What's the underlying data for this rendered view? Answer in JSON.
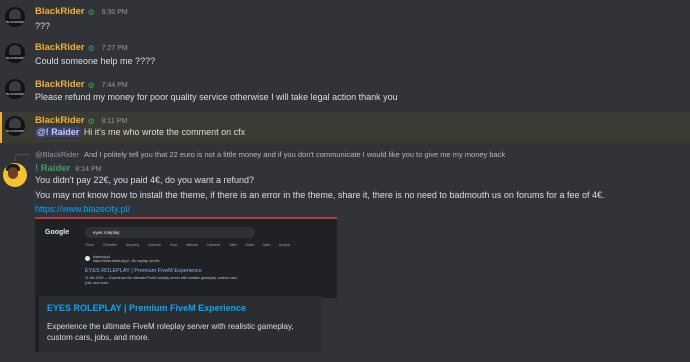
{
  "messages": [
    {
      "user": "BlackRider",
      "time": "6:30 PM",
      "text": "???"
    },
    {
      "user": "BlackRider",
      "time": "7:27 PM",
      "text": "Could someone help me ????"
    },
    {
      "user": "BlackRider",
      "time": "7:44 PM",
      "text": "Please refund my money for poor quality service otherwise I will take legal action thank you"
    },
    {
      "user": "BlackRider",
      "time": "8:11 PM",
      "mention": "@! Raider",
      "text": "Hi it's me who wrote the comment on cfx"
    }
  ],
  "avatar_tag": "BLACKRIDER",
  "reply_message": {
    "reply_to_user": "@BlackRider",
    "reply_to_text": "And I politely tell you that 22 euro is not a little money and if you don't communicate I would like you to give me my money back",
    "user": "! Raider",
    "time": "8:14 PM",
    "lines": [
      "You didn't pay 22€, you paid 4€, do you want a refund?",
      "You may not know how to install the theme, if there is an error in the theme, share it, there is no need to badmouth us on forums for a fee of 4€."
    ],
    "link": "https://www.blazecity.pl/"
  },
  "screenshot": {
    "logo": "Google",
    "query": "eyes roleplay",
    "tabs": "Tümü Görseller Alışveriş Videolar Kısa videolar Haberler Web Daha fazla Araçlar",
    "site_name": "blazecity.pl",
    "site_url": "https://www.blazecity.pl › Bu sayfayı çevirin",
    "result_title": "EYES ROLEPLAY | Premium FiveM Experience",
    "result_desc_1": "11 Nis 2025 — Experience the ultimate FiveM roleplay server with realistic gameplay, custom cars,",
    "result_desc_2": "jobs, and more."
  },
  "embed": {
    "title": "EYES ROLEPLAY | Premium FiveM Experience",
    "description": "Experience the ultimate FiveM roleplay server with realistic gameplay, custom cars, jobs, and more."
  },
  "colors": {
    "background": "#313338",
    "username_blackrider": "#f0b232",
    "username_raider": "#3ba55d",
    "link": "#00a8fc",
    "highlight": "#3b3a33"
  },
  "icons": [
    "verified-badge-icon",
    "reply-spine-icon"
  ]
}
